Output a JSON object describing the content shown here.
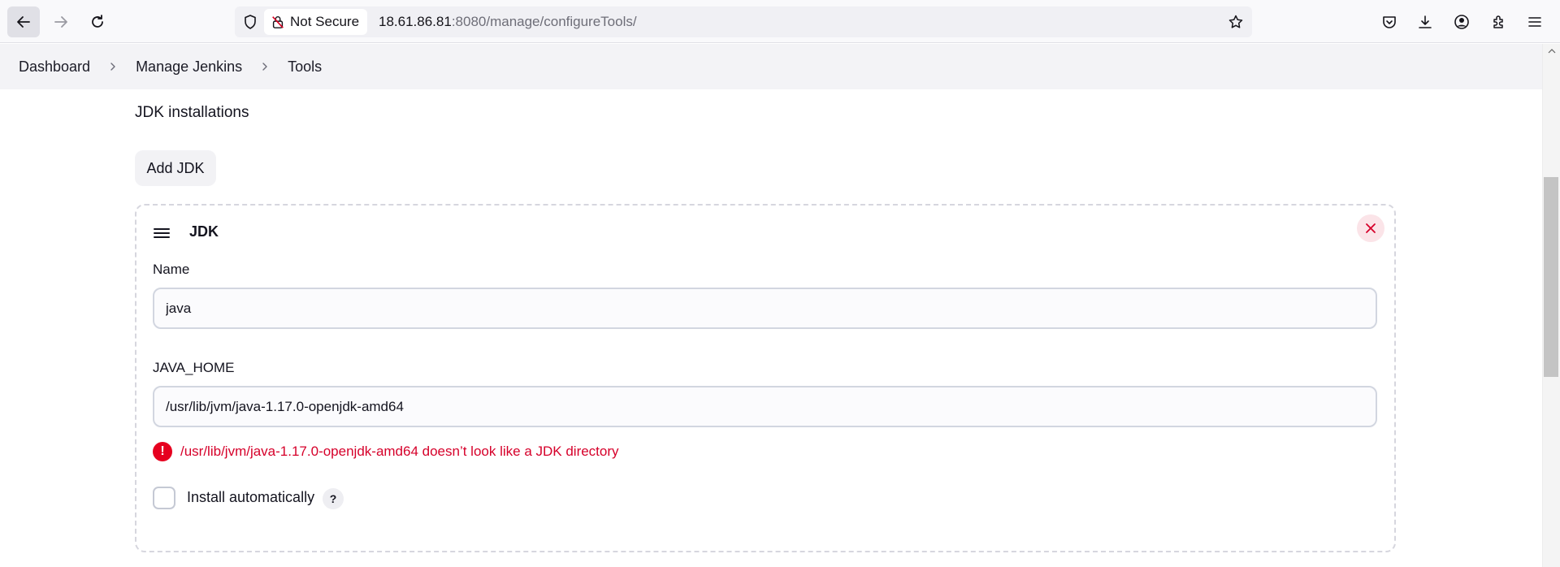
{
  "browser": {
    "security_label": "Not Secure",
    "url_host": "18.61.86.81",
    "url_path": ":8080/manage/configureTools/",
    "icons": [
      "back-arrow-icon",
      "forward-arrow-icon",
      "reload-icon",
      "shield-icon",
      "insecure-lock-icon",
      "bookmark-star-icon",
      "pocket-icon",
      "download-icon",
      "account-icon",
      "extensions-icon",
      "menu-icon"
    ]
  },
  "breadcrumb": {
    "items": [
      "Dashboard",
      "Manage Jenkins",
      "Tools"
    ]
  },
  "section": {
    "title": "JDK installations",
    "add_button": "Add JDK"
  },
  "jdk_card": {
    "title": "JDK",
    "name_label": "Name",
    "name_value": "java",
    "java_home_label": "JAVA_HOME",
    "java_home_value": "/usr/lib/jvm/java-1.17.0-openjdk-amd64",
    "error_message": "/usr/lib/jvm/java-1.17.0-openjdk-amd64 doesn’t look like a JDK directory",
    "install_auto_label": "Install automatically",
    "install_auto_checked": false,
    "help_label": "?"
  },
  "colors": {
    "error": "#d6002a",
    "close_bg": "#fbe4e8",
    "close_icon": "#d6002a"
  }
}
